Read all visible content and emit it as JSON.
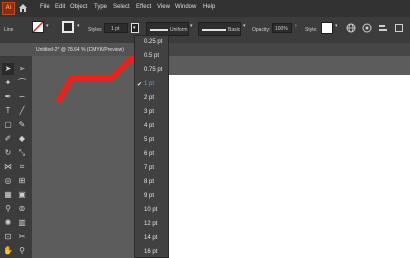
{
  "app": {
    "logo_text": "Ai"
  },
  "menu": [
    "File",
    "Edit",
    "Object",
    "Type",
    "Select",
    "Effect",
    "View",
    "Window",
    "Help"
  ],
  "control_bar": {
    "selection_label": "Line",
    "stroke_value": "1 pt",
    "styles_label": "Styles",
    "profile_label": "Uniform",
    "brush_label": "Basic",
    "opacity_label": "Opacity:",
    "opacity_value": "100%",
    "style_label": "Style:"
  },
  "document_tab": {
    "title": "Untitled-2* @ 78.64 % (CMYK/Preview)"
  },
  "stroke_dropdown": {
    "selected": "1 pt",
    "options": [
      "0.25 pt",
      "0.5 pt",
      "0.75 pt",
      "1 pt",
      "2 pt",
      "3 pt",
      "4 pt",
      "5 pt",
      "6 pt",
      "7 pt",
      "8 pt",
      "9 pt",
      "10 pt",
      "12 pt",
      "14 pt",
      "16 pt"
    ]
  },
  "colors": {
    "menubar": "#323232",
    "panel": "#3c3c3c",
    "canvas": "#5c5c5c",
    "artboard": "#ffffff",
    "path_red": "#e8231e",
    "selected_text": "#5b9bf0"
  }
}
